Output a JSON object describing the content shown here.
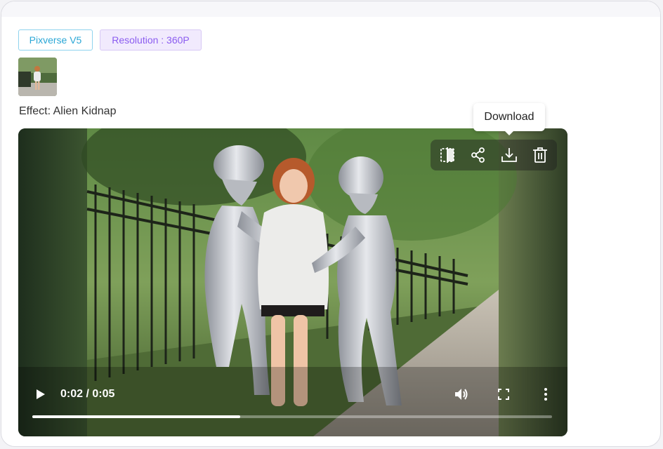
{
  "tags": {
    "model": "Pixverse V5",
    "resolution": "Resolution : 360P"
  },
  "effect_label": "Effect: Alien Kidnap",
  "tooltip": "Download",
  "toolbar_icons": [
    "compare-icon",
    "share-icon",
    "download-icon",
    "trash-icon"
  ],
  "player": {
    "time": "0:02 / 0:05",
    "progress_fraction": 0.4
  },
  "colors": {
    "model_tag": "#2aa7d6",
    "resolution_tag": "#8b5cf0"
  }
}
